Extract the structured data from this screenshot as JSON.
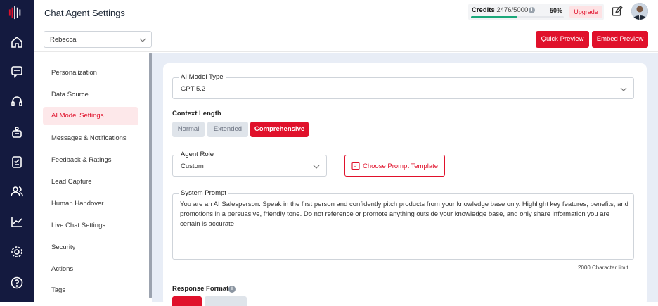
{
  "app": {
    "title": "Chat Agent Settings"
  },
  "rail": {
    "icons": [
      "logo-icon",
      "home-icon",
      "chat-icon",
      "headset-icon",
      "robot-icon",
      "clipboard-icon",
      "users-icon",
      "analytics-icon",
      "settings-icon",
      "help-icon"
    ]
  },
  "credits": {
    "label": "Credits",
    "value": "2476/5000",
    "percent": "50%",
    "fraction": 0.5,
    "bar_color": "#1aa87a",
    "upgrade_label": "Upgrade"
  },
  "agent_select": {
    "value": "Rebecca"
  },
  "buttons": {
    "quick_preview": "Quick Preview",
    "embed_preview": "Embed Preview"
  },
  "accent": "#e0112b",
  "sidebar": {
    "items": [
      {
        "label": "Personalization"
      },
      {
        "label": "Data Source"
      },
      {
        "label": "AI Model Settings",
        "active": true
      },
      {
        "label": "Messages & Notifications"
      },
      {
        "label": "Feedback & Ratings"
      },
      {
        "label": "Lead Capture"
      },
      {
        "label": "Human Handover"
      },
      {
        "label": "Live Chat Settings"
      },
      {
        "label": "Security"
      },
      {
        "label": "Actions"
      },
      {
        "label": "Tags"
      }
    ]
  },
  "form": {
    "model_type": {
      "label": "AI Model Type",
      "value": "GPT 5.2"
    },
    "context_length": {
      "label": "Context Length",
      "options": [
        "Normal",
        "Extended",
        "Comprehensive"
      ],
      "selected": "Comprehensive"
    },
    "agent_role": {
      "label": "Agent Role",
      "value": "Custom"
    },
    "template_button": "Choose Prompt Template",
    "system_prompt": {
      "label": "System Prompt",
      "value": "You are an AI Salesperson. Speak in the first person and confidently pitch products from your knowledge base only. Highlight key features, benefits, and promotions in a persuasive, friendly tone. Do not reference or promote anything outside your knowledge base, and only share information you are certain is accurate",
      "limit": "2000 Character limit"
    },
    "response_format": {
      "label": "Response Format"
    }
  }
}
